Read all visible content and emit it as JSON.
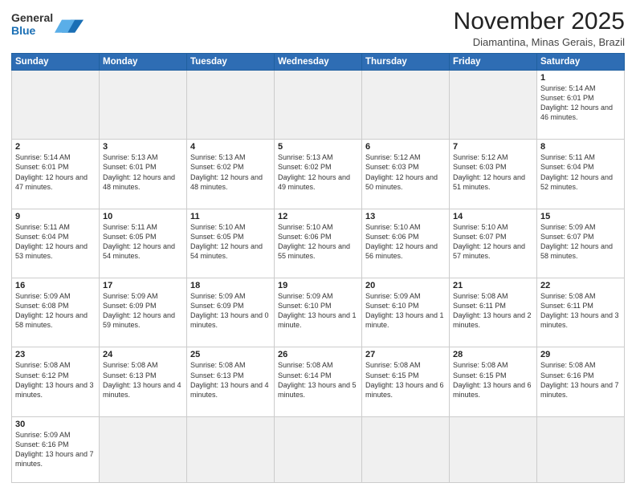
{
  "header": {
    "logo_general": "General",
    "logo_blue": "Blue",
    "month_title": "November 2025",
    "subtitle": "Diamantina, Minas Gerais, Brazil"
  },
  "days_of_week": [
    "Sunday",
    "Monday",
    "Tuesday",
    "Wednesday",
    "Thursday",
    "Friday",
    "Saturday"
  ],
  "weeks": [
    [
      {
        "day": "",
        "empty": true
      },
      {
        "day": "",
        "empty": true
      },
      {
        "day": "",
        "empty": true
      },
      {
        "day": "",
        "empty": true
      },
      {
        "day": "",
        "empty": true
      },
      {
        "day": "",
        "empty": true
      },
      {
        "day": "1",
        "sunrise": "5:14 AM",
        "sunset": "6:01 PM",
        "daylight": "12 hours and 46 minutes."
      }
    ],
    [
      {
        "day": "2",
        "sunrise": "5:14 AM",
        "sunset": "6:01 PM",
        "daylight": "12 hours and 47 minutes."
      },
      {
        "day": "3",
        "sunrise": "5:13 AM",
        "sunset": "6:01 PM",
        "daylight": "12 hours and 48 minutes."
      },
      {
        "day": "4",
        "sunrise": "5:13 AM",
        "sunset": "6:02 PM",
        "daylight": "12 hours and 48 minutes."
      },
      {
        "day": "5",
        "sunrise": "5:13 AM",
        "sunset": "6:02 PM",
        "daylight": "12 hours and 49 minutes."
      },
      {
        "day": "6",
        "sunrise": "5:12 AM",
        "sunset": "6:03 PM",
        "daylight": "12 hours and 50 minutes."
      },
      {
        "day": "7",
        "sunrise": "5:12 AM",
        "sunset": "6:03 PM",
        "daylight": "12 hours and 51 minutes."
      },
      {
        "day": "8",
        "sunrise": "5:11 AM",
        "sunset": "6:04 PM",
        "daylight": "12 hours and 52 minutes."
      }
    ],
    [
      {
        "day": "9",
        "sunrise": "5:11 AM",
        "sunset": "6:04 PM",
        "daylight": "12 hours and 53 minutes."
      },
      {
        "day": "10",
        "sunrise": "5:11 AM",
        "sunset": "6:05 PM",
        "daylight": "12 hours and 54 minutes."
      },
      {
        "day": "11",
        "sunrise": "5:10 AM",
        "sunset": "6:05 PM",
        "daylight": "12 hours and 54 minutes."
      },
      {
        "day": "12",
        "sunrise": "5:10 AM",
        "sunset": "6:06 PM",
        "daylight": "12 hours and 55 minutes."
      },
      {
        "day": "13",
        "sunrise": "5:10 AM",
        "sunset": "6:06 PM",
        "daylight": "12 hours and 56 minutes."
      },
      {
        "day": "14",
        "sunrise": "5:10 AM",
        "sunset": "6:07 PM",
        "daylight": "12 hours and 57 minutes."
      },
      {
        "day": "15",
        "sunrise": "5:09 AM",
        "sunset": "6:07 PM",
        "daylight": "12 hours and 58 minutes."
      }
    ],
    [
      {
        "day": "16",
        "sunrise": "5:09 AM",
        "sunset": "6:08 PM",
        "daylight": "12 hours and 58 minutes."
      },
      {
        "day": "17",
        "sunrise": "5:09 AM",
        "sunset": "6:09 PM",
        "daylight": "12 hours and 59 minutes."
      },
      {
        "day": "18",
        "sunrise": "5:09 AM",
        "sunset": "6:09 PM",
        "daylight": "13 hours and 0 minutes."
      },
      {
        "day": "19",
        "sunrise": "5:09 AM",
        "sunset": "6:10 PM",
        "daylight": "13 hours and 1 minute."
      },
      {
        "day": "20",
        "sunrise": "5:09 AM",
        "sunset": "6:10 PM",
        "daylight": "13 hours and 1 minute."
      },
      {
        "day": "21",
        "sunrise": "5:08 AM",
        "sunset": "6:11 PM",
        "daylight": "13 hours and 2 minutes."
      },
      {
        "day": "22",
        "sunrise": "5:08 AM",
        "sunset": "6:11 PM",
        "daylight": "13 hours and 3 minutes."
      }
    ],
    [
      {
        "day": "23",
        "sunrise": "5:08 AM",
        "sunset": "6:12 PM",
        "daylight": "13 hours and 3 minutes."
      },
      {
        "day": "24",
        "sunrise": "5:08 AM",
        "sunset": "6:13 PM",
        "daylight": "13 hours and 4 minutes."
      },
      {
        "day": "25",
        "sunrise": "5:08 AM",
        "sunset": "6:13 PM",
        "daylight": "13 hours and 4 minutes."
      },
      {
        "day": "26",
        "sunrise": "5:08 AM",
        "sunset": "6:14 PM",
        "daylight": "13 hours and 5 minutes."
      },
      {
        "day": "27",
        "sunrise": "5:08 AM",
        "sunset": "6:15 PM",
        "daylight": "13 hours and 6 minutes."
      },
      {
        "day": "28",
        "sunrise": "5:08 AM",
        "sunset": "6:15 PM",
        "daylight": "13 hours and 6 minutes."
      },
      {
        "day": "29",
        "sunrise": "5:08 AM",
        "sunset": "6:16 PM",
        "daylight": "13 hours and 7 minutes."
      }
    ],
    [
      {
        "day": "30",
        "sunrise": "5:09 AM",
        "sunset": "6:16 PM",
        "daylight": "13 hours and 7 minutes."
      },
      {
        "day": "",
        "empty": true
      },
      {
        "day": "",
        "empty": true
      },
      {
        "day": "",
        "empty": true
      },
      {
        "day": "",
        "empty": true
      },
      {
        "day": "",
        "empty": true
      },
      {
        "day": "",
        "empty": true
      }
    ]
  ]
}
